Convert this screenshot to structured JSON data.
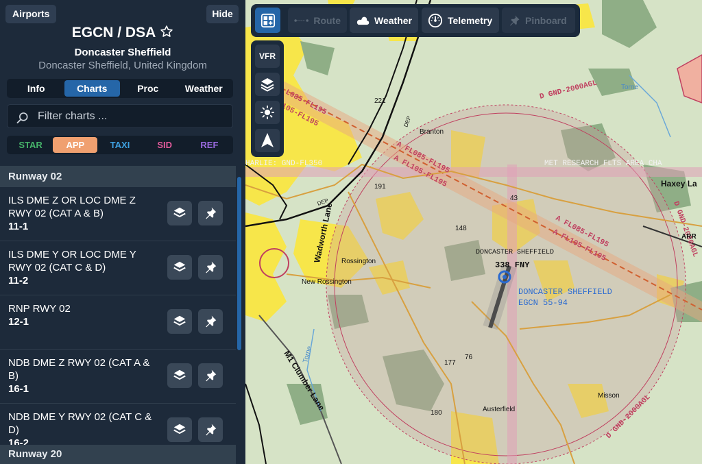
{
  "sidebar": {
    "airports_label": "Airports",
    "hide_label": "Hide",
    "airport_code": "EGCN / DSA",
    "airport_name": "Doncaster Sheffield",
    "airport_location": "Doncaster Sheffield, United Kingdom",
    "tabs": [
      {
        "label": "Info"
      },
      {
        "label": "Charts"
      },
      {
        "label": "Proc"
      },
      {
        "label": "Weather"
      }
    ],
    "search_placeholder": "Filter charts ...",
    "filters": [
      {
        "label": "STAR",
        "color": "#46b36a"
      },
      {
        "label": "APP",
        "color": "#ffffff"
      },
      {
        "label": "TAXI",
        "color": "#3ea0e0"
      },
      {
        "label": "SID",
        "color": "#e05a9a"
      },
      {
        "label": "REF",
        "color": "#9a6ae0"
      }
    ],
    "sections": [
      {
        "label": "Runway 02",
        "charts": [
          {
            "title": "ILS DME Z OR LOC DME Z RWY 02 (CAT A & B)",
            "code": "11-1"
          },
          {
            "title": "ILS DME Y OR LOC DME Y RWY 02 (CAT C & D)",
            "code": "11-2"
          },
          {
            "title": "RNP RWY 02",
            "code": "12-1"
          },
          {
            "title": "NDB DME Z RWY 02 (CAT A & B)",
            "code": "16-1"
          },
          {
            "title": "NDB DME Y RWY 02 (CAT C & D)",
            "code": "16-2"
          }
        ]
      },
      {
        "label": "Runway 20"
      }
    ]
  },
  "toolbar": {
    "route_label": "Route",
    "weather_label": "Weather",
    "telemetry_label": "Telemetry",
    "pinboard_label": "Pinboard"
  },
  "map_tools": {
    "vfr_label": "VFR"
  },
  "map_labels": {
    "airport_name": "DONCASTER SHEFFIELD",
    "airport_code": "EGCN  55-94",
    "beacon": "DONCASTER SHEFFIELD",
    "beacon_id": "338 FNY",
    "airspace_1": "A FL085-FL195",
    "airspace_2": "A FL105-FL195",
    "airspace_3": "A FL085-FL195",
    "airspace_4": "A FL105-FL195",
    "airspace_nw1": "L085-FL195",
    "airspace_nw2": "105-FL195",
    "atz": "D GND-2000AGL",
    "charlie": "HARLIE: GND-FL350",
    "met": "MET RESEARCH FLTS AREA CHA",
    "branton": "Branton",
    "rossington": "Rossington",
    "new_rossington": "New Rossington",
    "austerfield": "Austerfield",
    "misson": "Misson",
    "torne1": "Torne",
    "torne2": "Torne",
    "haxey": "Haxey La",
    "wadworth": "Wadworth Lane",
    "m1": "M1 Clumber Lane",
    "dep1": "DEP",
    "dep2": "DEP",
    "spot_221": "221",
    "spot_191": "191",
    "spot_148": "148",
    "spot_43": "43",
    "spot_177": "177",
    "spot_76": "76",
    "spot_180": "180",
    "arr": "ARR"
  }
}
